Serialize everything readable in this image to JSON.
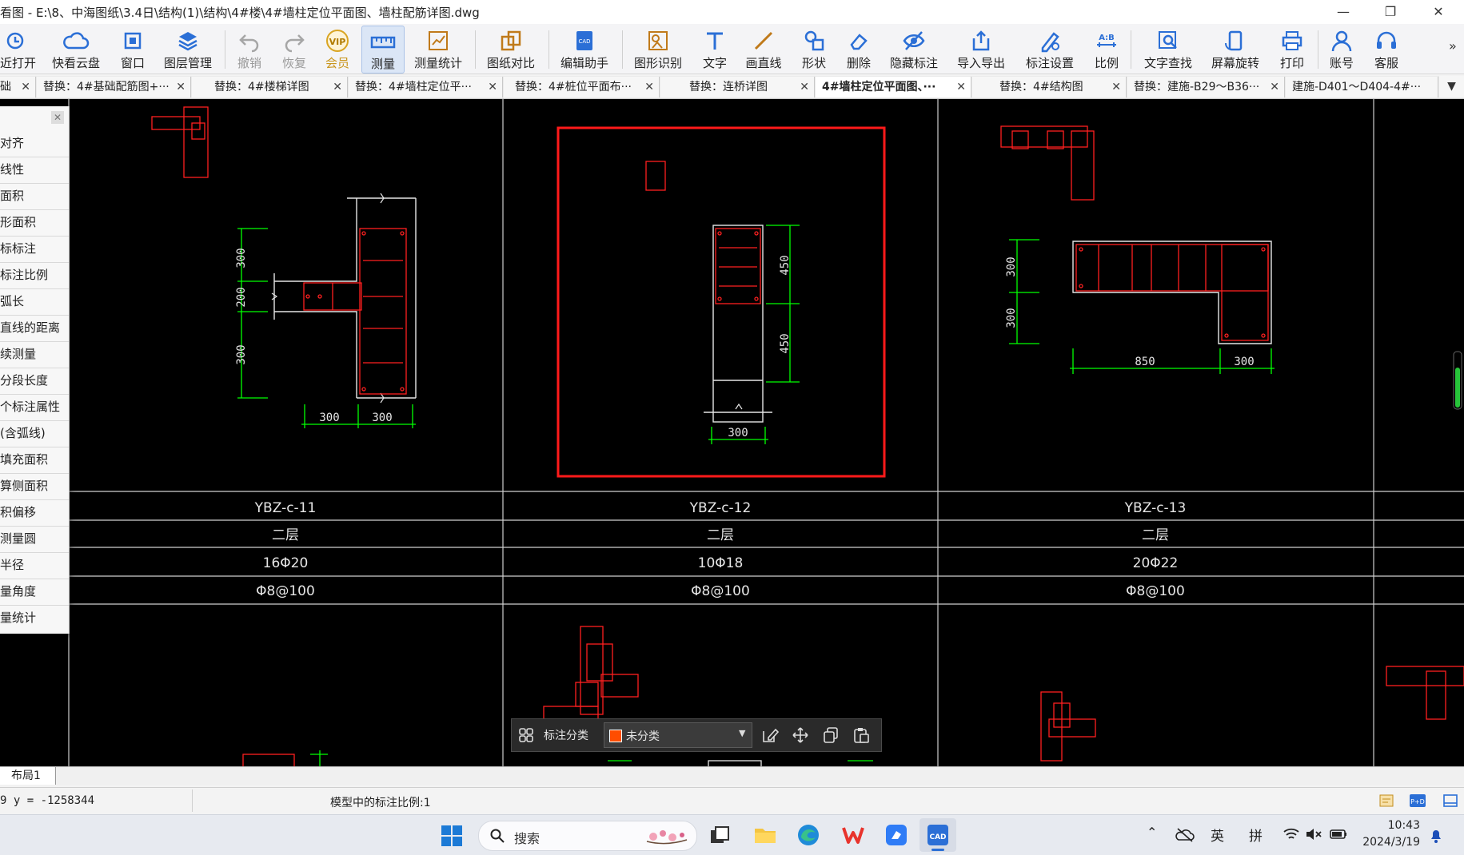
{
  "window": {
    "title": "看图 - E:\\8、中海图纸\\3.4日\\结构(1)\\结构\\4#楼\\4#墙柱定位平面图、墙柱配筋详图.dwg",
    "minimize": "—",
    "maximize": "❐",
    "close": "✕"
  },
  "toolbar": {
    "items": [
      {
        "label": "近打开",
        "icon": "recent-open-icon"
      },
      {
        "label": "快看云盘",
        "icon": "cloud-icon"
      },
      {
        "label": "窗口",
        "icon": "window-icon"
      },
      {
        "label": "图层管理",
        "icon": "layers-icon"
      },
      {
        "label": "撤销",
        "icon": "undo-icon"
      },
      {
        "label": "恢复",
        "icon": "redo-icon"
      },
      {
        "label": "会员",
        "icon": "vip-icon",
        "badge": "VIP"
      },
      {
        "label": "测量",
        "icon": "ruler-icon"
      },
      {
        "label": "测量统计",
        "icon": "measure-stats-icon"
      },
      {
        "label": "图纸对比",
        "icon": "compare-icon"
      },
      {
        "label": "编辑助手",
        "icon": "cad-edit-icon"
      },
      {
        "label": "图形识别",
        "icon": "shape-recognize-icon"
      },
      {
        "label": "文字",
        "icon": "text-icon"
      },
      {
        "label": "画直线",
        "icon": "line-icon"
      },
      {
        "label": "形状",
        "icon": "shapes-icon"
      },
      {
        "label": "删除",
        "icon": "eraser-icon"
      },
      {
        "label": "隐藏标注",
        "icon": "hide-icon"
      },
      {
        "label": "导入导出",
        "icon": "import-export-icon"
      },
      {
        "label": "标注设置",
        "icon": "annotation-settings-icon"
      },
      {
        "label": "比例",
        "icon": "scale-icon",
        "badge": "A:B"
      },
      {
        "label": "文字查找",
        "icon": "text-search-icon"
      },
      {
        "label": "屏幕旋转",
        "icon": "rotate-screen-icon"
      },
      {
        "label": "打印",
        "icon": "print-icon"
      },
      {
        "label": "账号",
        "icon": "account-icon"
      },
      {
        "label": "客服",
        "icon": "headset-icon"
      }
    ],
    "more": "»"
  },
  "tabs": [
    {
      "label": "础"
    },
    {
      "label": "替换：4#基础配筋图+···"
    },
    {
      "label": "替换：4#楼梯详图"
    },
    {
      "label": "替换：4#墙柱定位平···"
    },
    {
      "label": "替换：4#桩位平面布···"
    },
    {
      "label": "替换：连桥详图"
    },
    {
      "label": "4#墙柱定位平面图、···"
    },
    {
      "label": "替换：4#结构图"
    },
    {
      "label": "替换：建施-B29～B36···"
    },
    {
      "label": "建施-D401～D404-4#···"
    }
  ],
  "tab_close": "✕",
  "tab_dropdown": "▼",
  "left_panel": {
    "close": "✕",
    "items": [
      "对齐",
      "线性",
      "面积",
      "形面积",
      "标标注",
      "标注比例",
      "弧长",
      "直线的距离",
      "续测量",
      "分段长度",
      "个标注属性",
      "(含弧线)",
      "填充面积",
      "算侧面积",
      "积偏移",
      "测量圆",
      "半径",
      "量角度",
      "量统计"
    ]
  },
  "drawing": {
    "columns": [
      {
        "name": "YBZ-c-11",
        "floor": "二层",
        "main_rebar": "16Φ20",
        "stirrup": "Φ8@100",
        "dims": {
          "v1": "300",
          "v2": "200",
          "v3": "300",
          "h1": "300",
          "h2": "300"
        }
      },
      {
        "name": "YBZ-c-12",
        "floor": "二层",
        "main_rebar": "10Φ18",
        "stirrup": "Φ8@100",
        "dims": {
          "v1": "450",
          "v2": "450",
          "h1": "300"
        }
      },
      {
        "name": "YBZ-c-13",
        "floor": "二层",
        "main_rebar": "20Φ22",
        "stirrup": "Φ8@100",
        "dims": {
          "v1": "300",
          "v2": "300",
          "h1": "850",
          "h2": "300"
        }
      }
    ]
  },
  "float_toolbar": {
    "category_label": "标注分类",
    "category_value": "未分类",
    "category_color": "#ff4d00"
  },
  "layout_tab": "布局1",
  "status": {
    "coords": "9 y = -1258344",
    "scale_text": "模型中的标注比例:1"
  },
  "taskbar": {
    "search_placeholder": "搜索",
    "ime_lang": "英",
    "ime_mode": "拼",
    "time": "10:43",
    "date": "2024/3/19"
  },
  "colors": {
    "accent": "#2b6fd6",
    "cad_green": "#00ff00",
    "cad_red": "#ff2020",
    "selection": "#ff1a1a"
  }
}
